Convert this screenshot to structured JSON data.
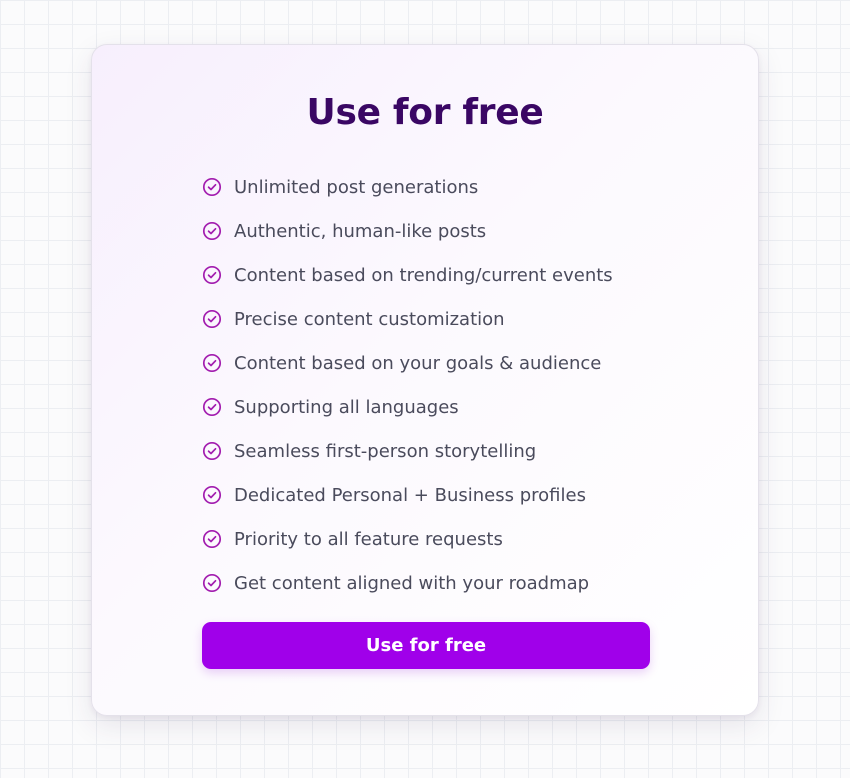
{
  "card": {
    "title": "Use for free",
    "features": [
      {
        "label": "Unlimited post generations",
        "icon": "check-circle-icon"
      },
      {
        "label": "Authentic, human-like posts",
        "icon": "check-circle-icon"
      },
      {
        "label": "Content based on trending/current events",
        "icon": "check-circle-icon"
      },
      {
        "label": "Precise content customization",
        "icon": "check-circle-icon"
      },
      {
        "label": "Content based on your goals & audience",
        "icon": "check-circle-icon"
      },
      {
        "label": "Supporting all languages",
        "icon": "check-circle-icon"
      },
      {
        "label": "Seamless first-person storytelling",
        "icon": "check-circle-icon"
      },
      {
        "label": "Dedicated Personal + Business profiles",
        "icon": "check-circle-icon"
      },
      {
        "label": "Priority to all feature requests",
        "icon": "check-circle-icon"
      },
      {
        "label": "Get content aligned with your roadmap",
        "icon": "check-circle-icon"
      }
    ],
    "cta_label": "Use for free"
  },
  "colors": {
    "title": "#3a0764",
    "accent": "#a000ea",
    "icon": "#a21caf",
    "text": "#4a4b5c"
  }
}
